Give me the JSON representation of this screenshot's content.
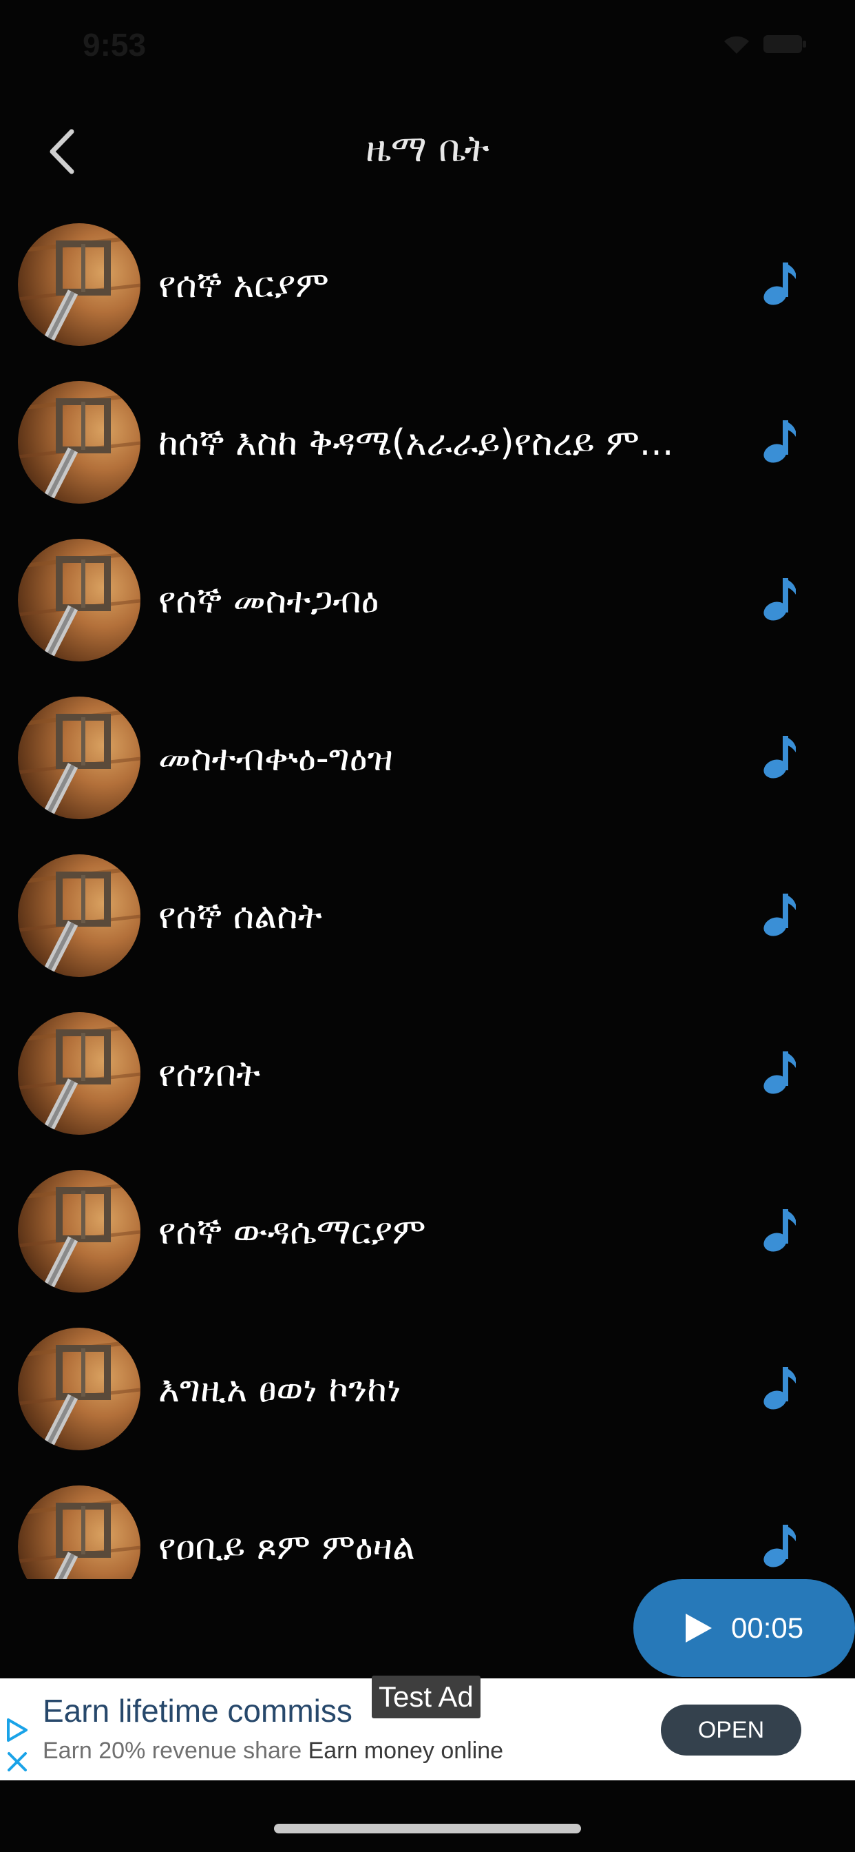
{
  "status_bar": {
    "time": "9:53"
  },
  "header": {
    "title": "ዜማ ቤት",
    "back_icon": "chevron-left-icon"
  },
  "tracks": [
    {
      "title": "የሰኞ አርያም",
      "icon": "music-note-icon"
    },
    {
      "title": "ከሰኞ እስከ ቅዳሜ(አራራይ)የስረይ ም...",
      "icon": "music-note-icon"
    },
    {
      "title": "የሰኞ መስተጋብዕ",
      "icon": "music-note-icon"
    },
    {
      "title": "መስተብቍዕ-ግዕዝ",
      "icon": "music-note-icon"
    },
    {
      "title": "የሰኞ ሰልስት",
      "icon": "music-note-icon"
    },
    {
      "title": "የሰንበት",
      "icon": "music-note-icon"
    },
    {
      "title": "የሰኞ ውዳሴማርያም",
      "icon": "music-note-icon"
    },
    {
      "title": "እግዚአ ፀወነ ኮንከነ",
      "icon": "music-note-icon"
    },
    {
      "title": "የዐቢይ ጾም ምዕዛል",
      "icon": "music-note-icon"
    }
  ],
  "player": {
    "elapsed": "00:05",
    "icon": "play-icon"
  },
  "ad": {
    "headline": "Earn lifetime commiss",
    "badge": "Test Ad",
    "body_prefix": "Earn 20% revenue share ",
    "body_strong": "Earn money online",
    "cta": "OPEN"
  },
  "colors": {
    "background": "#050505",
    "accent": "#2779b9",
    "note_icon": "#3a8fd6"
  }
}
